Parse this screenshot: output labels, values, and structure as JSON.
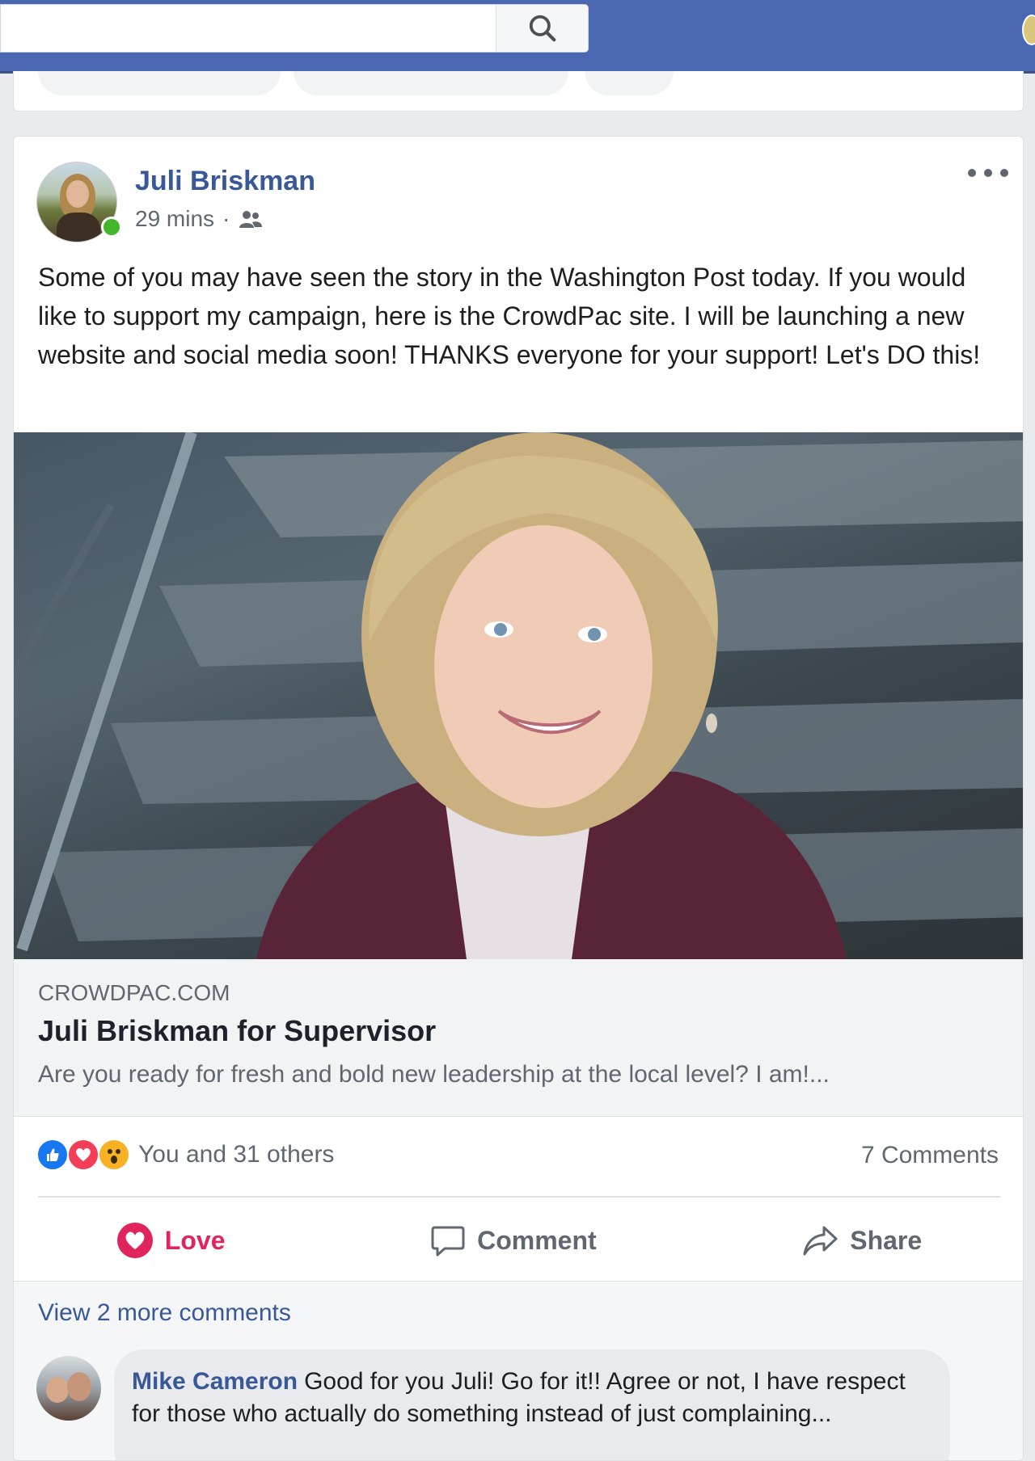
{
  "search": {
    "placeholder": ""
  },
  "post": {
    "author": "Juli Briskman",
    "time": "29 mins",
    "separator": "·",
    "text": "Some of you may have seen the story in the Washington Post today. If you would like to support my campaign, here is the CrowdPac site. I will be launching a new website and social media soon! THANKS everyone for your support! Let's DO this!",
    "link": {
      "domain": "CROWDPAC.COM",
      "title": "Juli Briskman for Supervisor",
      "description": "Are you ready for fresh and bold new leadership at the local level? I am!..."
    },
    "reactions": {
      "icons": [
        "like-icon",
        "love-icon",
        "wow-icon"
      ],
      "summary": "You and 31 others"
    },
    "comment_count": "7 Comments",
    "actions": {
      "love": "Love",
      "comment": "Comment",
      "share": "Share"
    },
    "active_reaction_color": "#e0245e"
  },
  "comments": {
    "view_more": "View 2 more comments",
    "items": [
      {
        "author": "Mike Cameron",
        "text": "Good for you Juli! Go for it!! Agree or not, I have respect for those who actually do something instead of just complaining..."
      }
    ]
  },
  "colors": {
    "topbar": "#4b67b1",
    "link": "#385898",
    "online": "#42b72a"
  }
}
